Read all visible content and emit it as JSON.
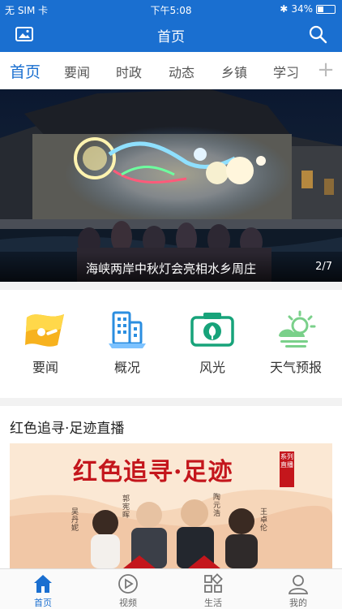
{
  "status": {
    "carrier": "无 SIM 卡",
    "time": "下午5:08",
    "battery": "34%"
  },
  "header": {
    "title": "首页",
    "icons": [
      "image-icon",
      "search-icon"
    ]
  },
  "tabs": [
    {
      "label": "首页"
    },
    {
      "label": "要闻"
    },
    {
      "label": "时政"
    },
    {
      "label": "动态"
    },
    {
      "label": "乡镇"
    },
    {
      "label": "学习"
    }
  ],
  "tabs_more": "+",
  "banner": {
    "caption": "海峡两岸中秋灯会亮相水乡周庄",
    "page": "2/7"
  },
  "grid": [
    {
      "label": "要闻",
      "icon": "news-flag-icon"
    },
    {
      "label": "概况",
      "icon": "building-icon"
    },
    {
      "label": "风光",
      "icon": "camera-icon"
    },
    {
      "label": "天气预报",
      "icon": "weather-icon"
    }
  ],
  "section": {
    "title": "红色追寻·足迹直播",
    "poster": {
      "headline": "红色追寻·足迹",
      "badge": "系列直播",
      "names": [
        "吴丹妮",
        "郭宪晖",
        "陶元浩",
        "王卓伦"
      ]
    }
  },
  "tabbar": [
    {
      "label": "首页",
      "icon": "home-icon"
    },
    {
      "label": "视频",
      "icon": "play-icon"
    },
    {
      "label": "生活",
      "icon": "apps-icon"
    },
    {
      "label": "我的",
      "icon": "person-icon"
    }
  ],
  "colors": {
    "primary": "#1a6fd0",
    "poster_red": "#c4161c"
  }
}
